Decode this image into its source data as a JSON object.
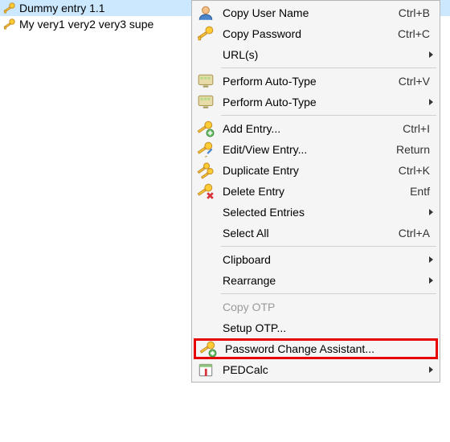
{
  "entries": [
    {
      "title": "Dummy entry 1.1",
      "selected": true
    },
    {
      "title": "My very1 very2 very3 supe",
      "selected": false
    }
  ],
  "menu": {
    "copy_user_name": "Copy User Name",
    "copy_user_name_sc": "Ctrl+B",
    "copy_password": "Copy Password",
    "copy_password_sc": "Ctrl+C",
    "urls": "URL(s)",
    "perform_auto_type": "Perform Auto-Type",
    "perform_auto_type_sc": "Ctrl+V",
    "perform_auto_type_sub": "Perform Auto-Type",
    "add_entry": "Add Entry...",
    "add_entry_sc": "Ctrl+I",
    "edit_view_entry": "Edit/View Entry...",
    "edit_view_entry_sc": "Return",
    "duplicate_entry": "Duplicate Entry",
    "duplicate_entry_sc": "Ctrl+K",
    "delete_entry": "Delete Entry",
    "delete_entry_sc": "Entf",
    "selected_entries": "Selected Entries",
    "select_all": "Select All",
    "select_all_sc": "Ctrl+A",
    "clipboard": "Clipboard",
    "rearrange": "Rearrange",
    "copy_otp": "Copy OTP",
    "setup_otp": "Setup OTP...",
    "password_change_assistant": "Password Change Assistant...",
    "pedcalc": "PEDCalc"
  }
}
